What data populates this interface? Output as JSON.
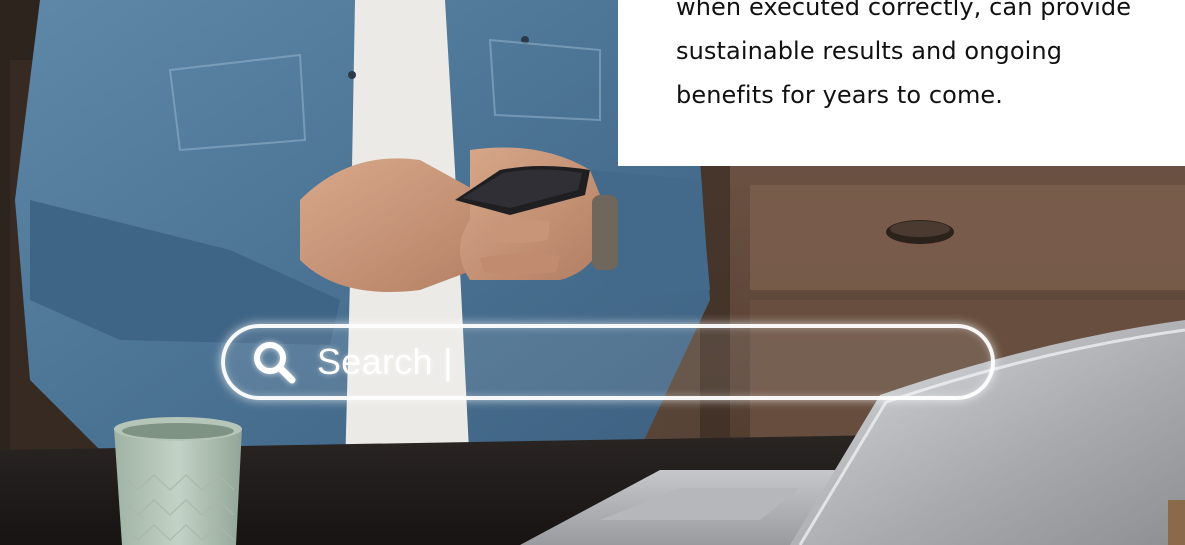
{
  "text_card": {
    "line_1": "when executed correctly, can provide",
    "line_2": "sustainable results and ongoing",
    "line_3": "benefits for years to come."
  },
  "search": {
    "icon": "search-icon",
    "text": "Search |"
  },
  "photo": {
    "icons": [
      "smartphone",
      "coffee-mug",
      "laptop"
    ]
  },
  "colors": {
    "card_background": "#ffffff",
    "card_text": "#111111",
    "search_border": "#ffffff"
  }
}
